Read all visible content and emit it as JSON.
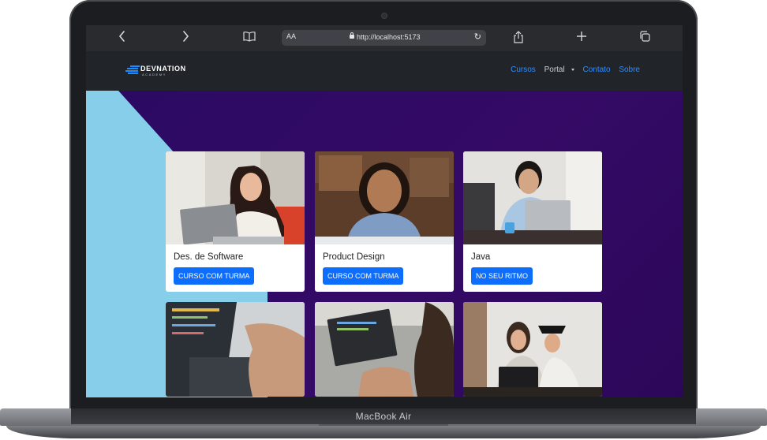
{
  "device": {
    "model_label": "MacBook Air"
  },
  "browser": {
    "text_size_label": "AA",
    "url": "http://localhost:5173",
    "icons": [
      "back-icon",
      "forward-icon",
      "bookmarks-icon",
      "lock-icon",
      "reload-icon",
      "share-icon",
      "new-tab-icon",
      "tabs-icon"
    ]
  },
  "site": {
    "logo": {
      "name": "DEVNATION",
      "tagline": "ACADEMY"
    },
    "nav": [
      {
        "label": "Cursos",
        "active": true
      },
      {
        "label": "Portal",
        "dropdown": true
      },
      {
        "label": "Contato",
        "active": true
      },
      {
        "label": "Sobre",
        "active": true
      }
    ],
    "colors": {
      "hero_bg": "#2e0961",
      "hero_accent": "#87ceeb",
      "button": "#0d6efd",
      "link": "#2f8cff"
    }
  },
  "courses": [
    {
      "title": "Des. de Software",
      "button": "CURSO COM TURMA"
    },
    {
      "title": "Product Design",
      "button": "CURSO COM TURMA"
    },
    {
      "title": "Java",
      "button": "NO SEU RITMO"
    },
    {
      "title": "",
      "button": ""
    },
    {
      "title": "",
      "button": ""
    },
    {
      "title": "",
      "button": ""
    }
  ]
}
